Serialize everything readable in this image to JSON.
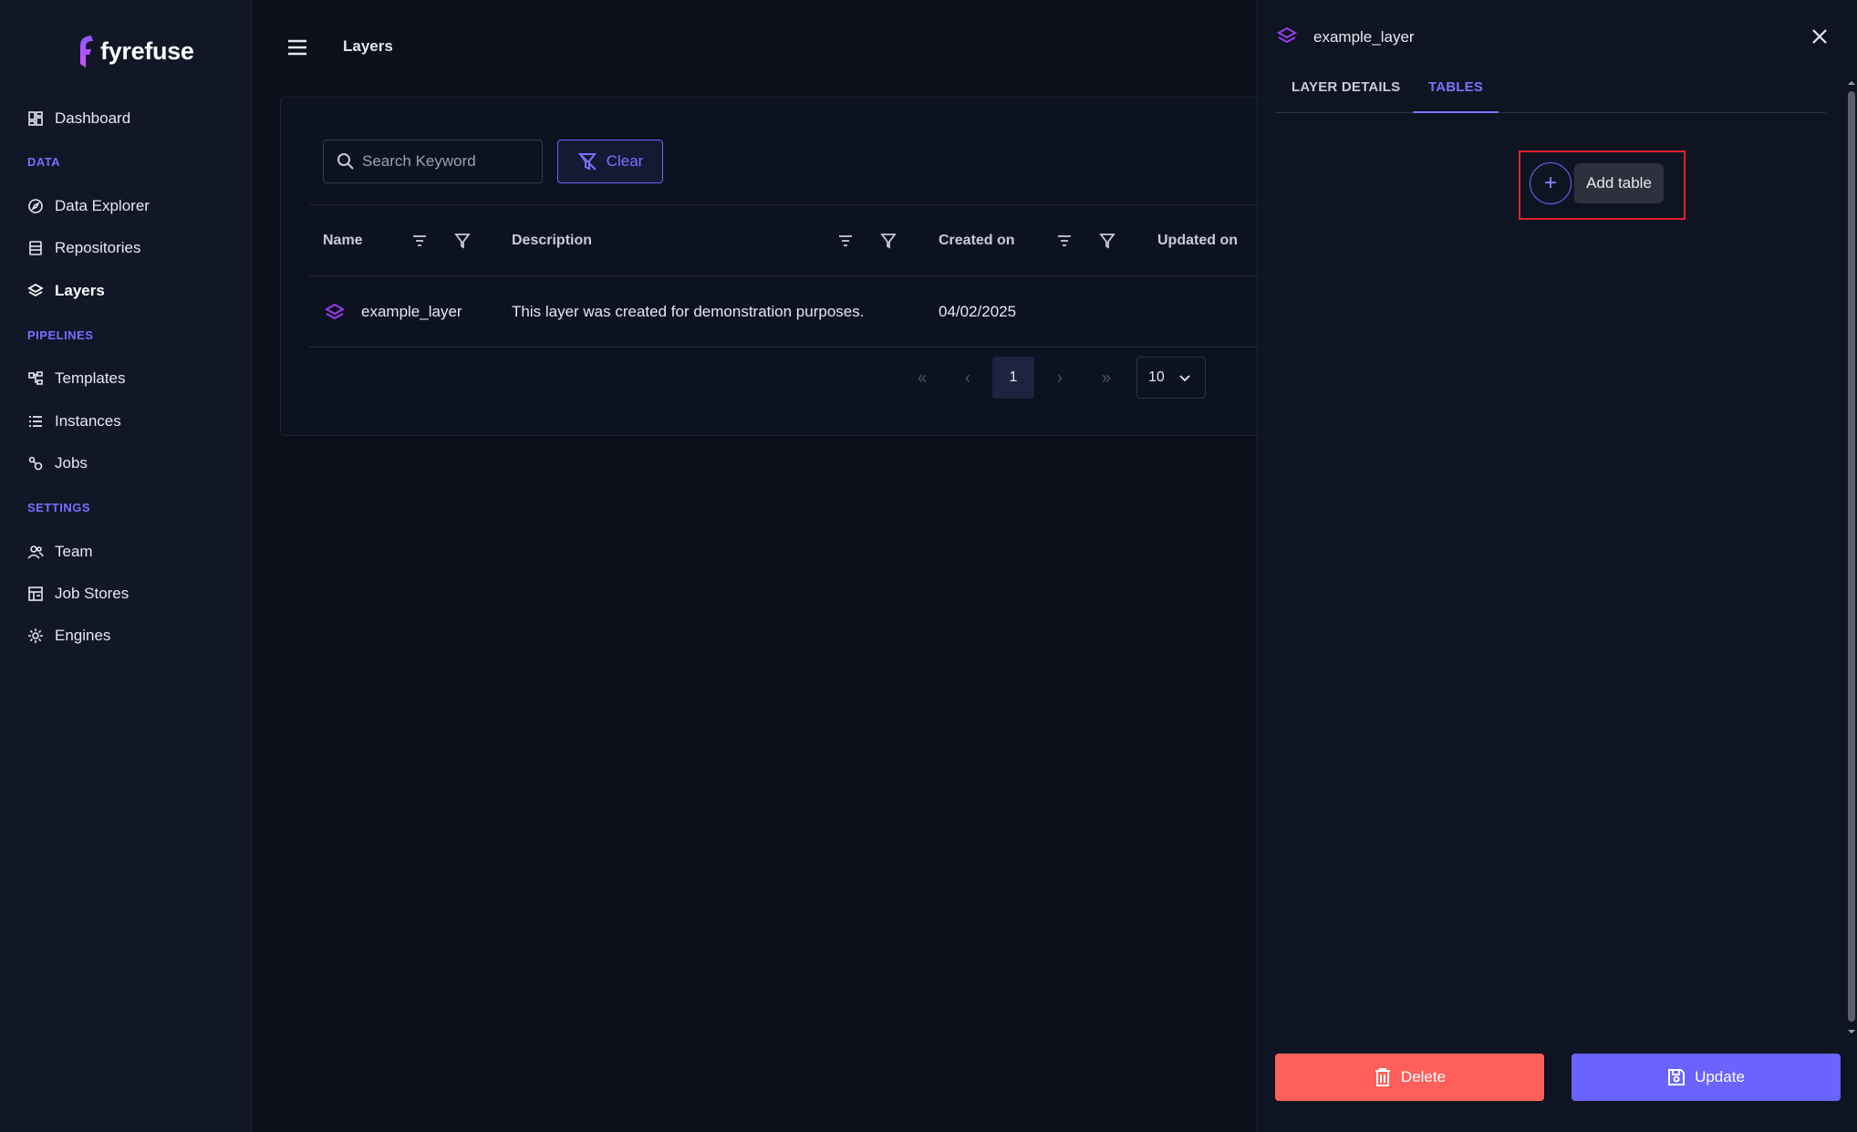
{
  "app": {
    "name": "fyrefuse",
    "brand_color": "#7b72ff"
  },
  "sidebar": {
    "dashboard": "Dashboard",
    "section_data": "DATA",
    "data_explorer": "Data Explorer",
    "repositories": "Repositories",
    "layers": "Layers",
    "section_pipelines": "PIPELINES",
    "templates": "Templates",
    "instances": "Instances",
    "jobs": "Jobs",
    "section_settings": "SETTINGS",
    "team": "Team",
    "job_stores": "Job Stores",
    "engines": "Engines"
  },
  "header": {
    "title": "Layers"
  },
  "toolbar": {
    "search_placeholder": "Search Keyword",
    "clear_label": "Clear"
  },
  "table": {
    "columns": [
      "Name",
      "Description",
      "Created on",
      "Updated on"
    ],
    "rows": [
      {
        "name": "example_layer",
        "description": "This layer was created for demonstration purposes.",
        "created_on": "04/02/2025",
        "updated_on": ""
      }
    ]
  },
  "pagination": {
    "current_page": "1",
    "page_size": "10",
    "first": "«",
    "prev": "‹",
    "next": "›",
    "last": "»"
  },
  "drawer": {
    "title": "example_layer",
    "tabs": [
      "LAYER DETAILS",
      "TABLES"
    ],
    "active_tab": "TABLES",
    "add_table_label": "Add table",
    "add_icon": "+",
    "delete_label": "Delete",
    "update_label": "Update",
    "delete_color": "#ff5f5a",
    "update_color": "#6a63ff"
  }
}
